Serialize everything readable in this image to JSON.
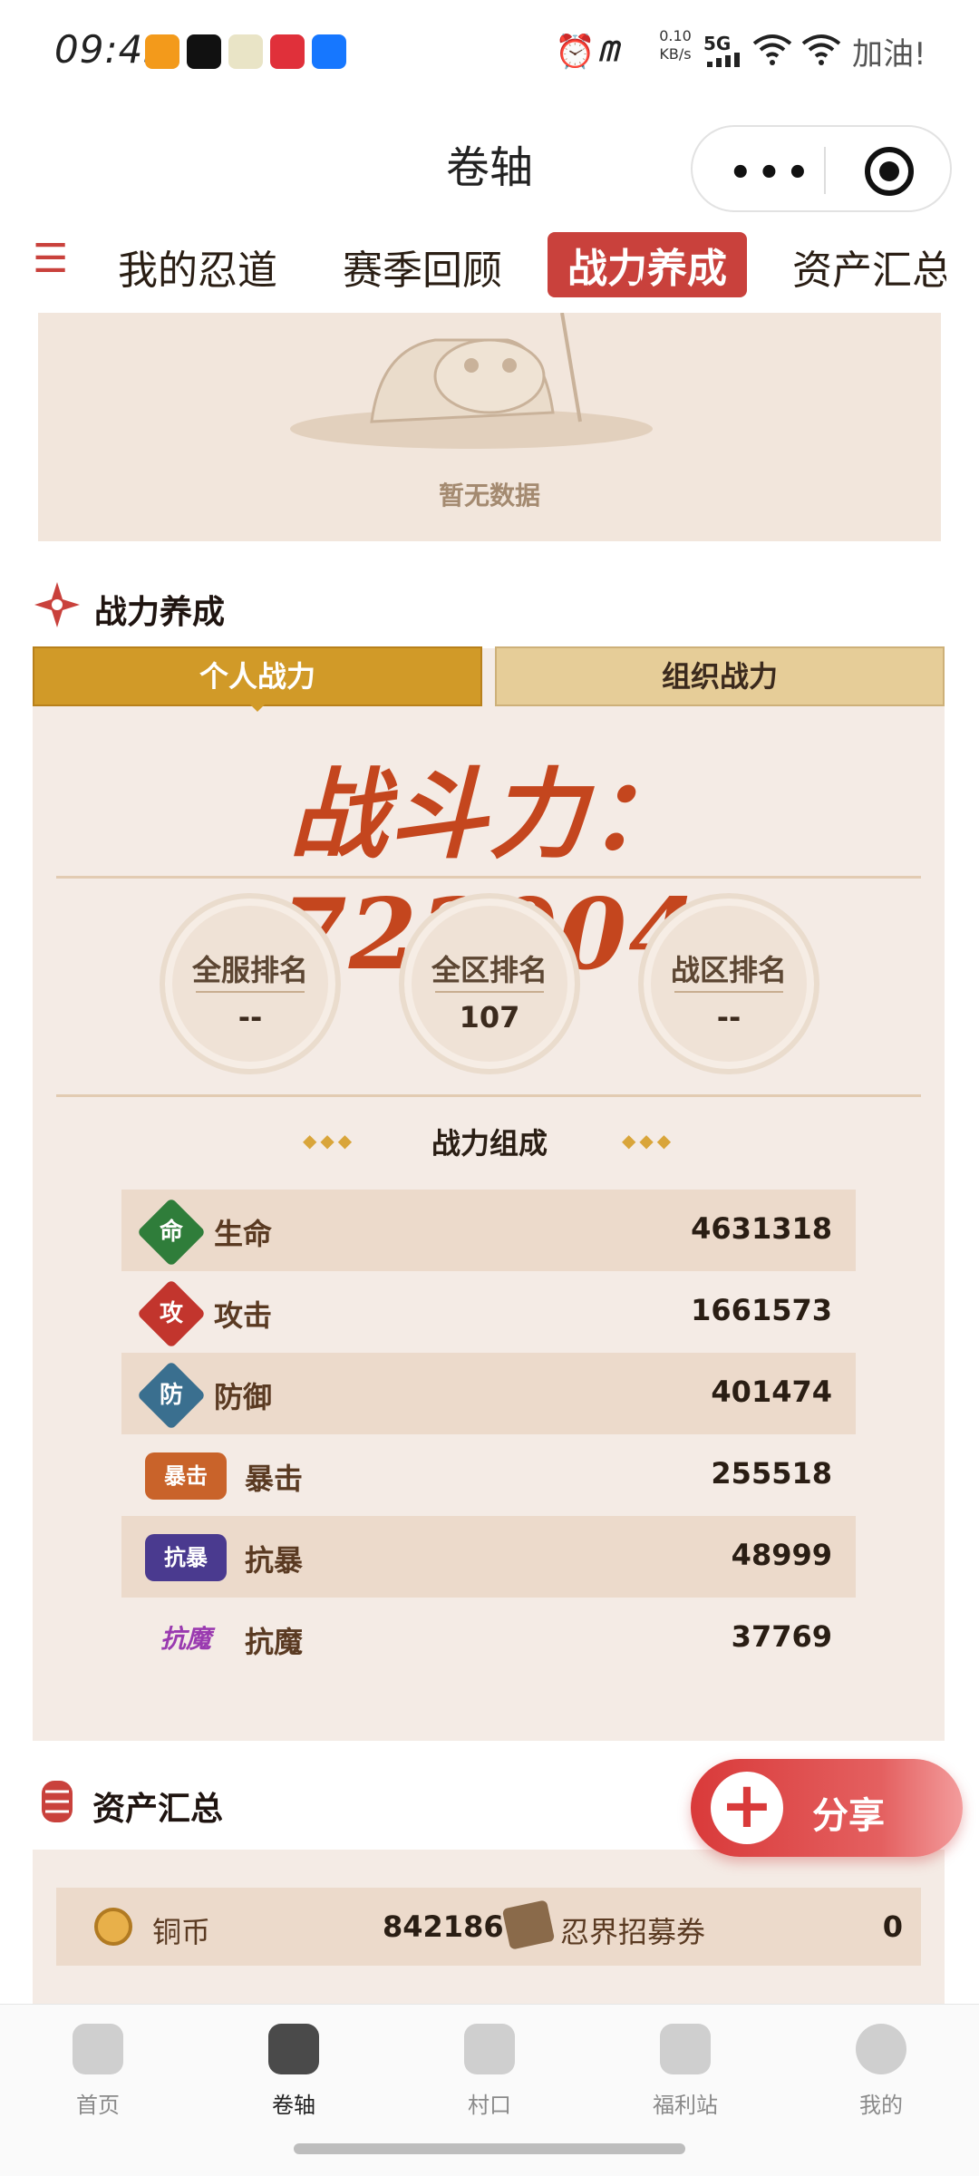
{
  "status_bar": {
    "time": "09:45",
    "net_speed": "0.10\nKB/s",
    "net_speed_top": "0.10",
    "net_speed_bottom": "KB/s",
    "signal": "5G",
    "extra": "加油!"
  },
  "window": {
    "title": "卷轴"
  },
  "tabs": [
    {
      "label": "我的忍道"
    },
    {
      "label": "赛季回顾"
    },
    {
      "label": "战力养成",
      "active": true
    },
    {
      "label": "资产汇总"
    }
  ],
  "empty_state": {
    "text": "暂无数据"
  },
  "power_section": {
    "title": "战力养成",
    "tab_personal": "个人战力",
    "tab_org": "组织战力",
    "power_text": "战斗力：17230040",
    "power_value": 17230040,
    "ranks": [
      {
        "label": "全服排名",
        "value": "--"
      },
      {
        "label": "全区排名",
        "value": "107"
      },
      {
        "label": "战区排名",
        "value": "--"
      }
    ],
    "composition_title": "战力组成",
    "stats": [
      {
        "icon": "命",
        "name": "生命",
        "value": "4631318",
        "color": "#2f7d3a"
      },
      {
        "icon": "攻",
        "name": "攻击",
        "value": "1661573",
        "color": "#c2352d"
      },
      {
        "icon": "防",
        "name": "防御",
        "value": "401474",
        "color": "#3a6f8f"
      },
      {
        "icon": "暴击",
        "name": "暴击",
        "value": "255518",
        "color": "#c9632a"
      },
      {
        "icon": "抗暴",
        "name": "抗暴",
        "value": "48999",
        "color": "#4a3a8f"
      },
      {
        "icon": "抗魔",
        "name": "抗魔",
        "value": "37769",
        "color": "#9a3ab0"
      }
    ]
  },
  "assets_section": {
    "title": "资产汇总",
    "rows": [
      {
        "left_name": "铜币",
        "left_value": "842186",
        "right_name": "忍界招募券",
        "right_value": "0"
      }
    ]
  },
  "share": {
    "label": "分享"
  },
  "bottom_nav": [
    {
      "label": "首页"
    },
    {
      "label": "卷轴",
      "active": true
    },
    {
      "label": "村口"
    },
    {
      "label": "福利站"
    },
    {
      "label": "我的"
    }
  ],
  "colors": {
    "accent": "#c9413c",
    "panel": "#f4ebe5",
    "gold": "#d19a28"
  }
}
